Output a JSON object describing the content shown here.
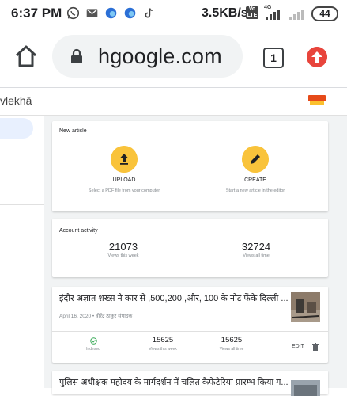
{
  "status_bar": {
    "time": "6:37 PM",
    "speed": "3.5KB/s",
    "volte": "Vo LTE",
    "network": "4G",
    "battery": "44",
    "icons": [
      "whatsapp-icon",
      "gmail-icon",
      "browser-icon",
      "browser-icon",
      "tiktok-icon"
    ]
  },
  "browser": {
    "url": "hgoogle.com",
    "tab_count": "1"
  },
  "page": {
    "site_title": "vlekhā"
  },
  "new_article": {
    "heading": "New article",
    "upload_label": "UPLOAD",
    "upload_desc": "Select a PDF file from your computer",
    "create_label": "CREATE",
    "create_desc": "Start a new article in the editor"
  },
  "account_activity": {
    "heading": "Account activity",
    "week_value": "21073",
    "week_label": "Views this week",
    "all_value": "32724",
    "all_label": "Views all time"
  },
  "articles": [
    {
      "title": "इंदौर अज्ञात शख्स ने कार से ,500,200 ,और, 100 के नोट फेंके दिल्ली ...",
      "meta": "April 16, 2020 • वीरेंद्र ठाकुर संपादक",
      "status": "Indexed",
      "week_value": "15625",
      "week_label": "Views this week",
      "all_value": "15625",
      "all_label": "Views all time",
      "edit_label": "EDIT"
    },
    {
      "title": "पुलिस अधीक्षक महोदय के मार्गदर्शन में चलित कैफेटेरिया प्रारम्भ किया ग..."
    }
  ],
  "colors": {
    "accent_yellow": "#f9c33b",
    "update_red": "#e8453c",
    "indexed_green": "#34a853",
    "sidebar_active": "#e8f0fe"
  }
}
